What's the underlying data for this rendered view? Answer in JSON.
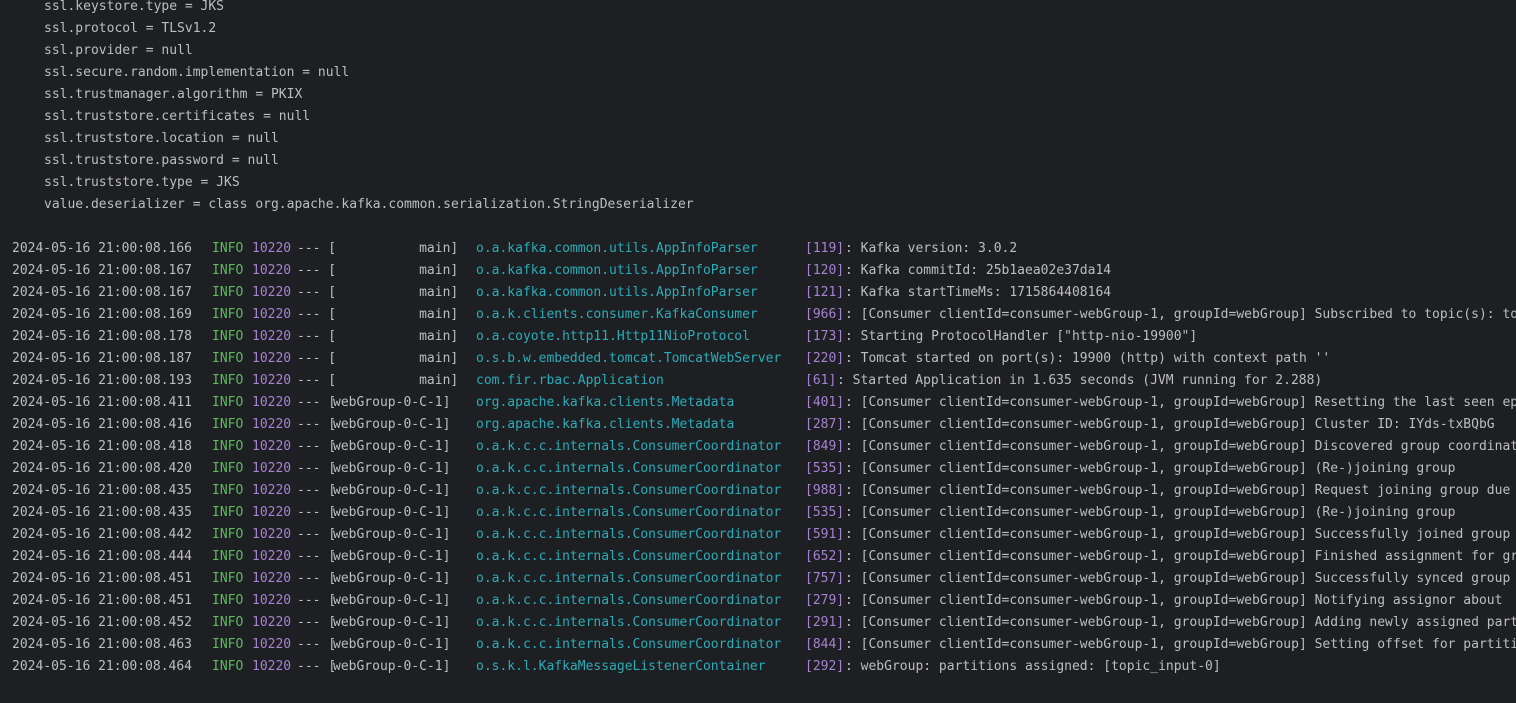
{
  "colors": {
    "background": "#1e1f22",
    "text": "#bcbec4",
    "level_info": "#5fb85f",
    "pid": "#a682d2",
    "logger": "#2aacb8",
    "line_number": "#a682d2"
  },
  "config_lines": [
    "ssl.keystore.type = JKS",
    "ssl.protocol = TLSv1.2",
    "ssl.provider = null",
    "ssl.secure.random.implementation = null",
    "ssl.trustmanager.algorithm = PKIX",
    "ssl.truststore.certificates = null",
    "ssl.truststore.location = null",
    "ssl.truststore.password = null",
    "ssl.truststore.type = JKS",
    "value.deserializer = class org.apache.kafka.common.serialization.StringDeserializer"
  ],
  "log_rows": [
    {
      "ts": "2024-05-16 21:00:08.166",
      "level": "INFO",
      "pid": "10220",
      "sep": "--- [",
      "thread": "           main]",
      "logger": "o.a.kafka.common.utils.AppInfoParser",
      "line": "[119]",
      "msg": ": Kafka version: 3.0.2"
    },
    {
      "ts": "2024-05-16 21:00:08.167",
      "level": "INFO",
      "pid": "10220",
      "sep": "--- [",
      "thread": "           main]",
      "logger": "o.a.kafka.common.utils.AppInfoParser",
      "line": "[120]",
      "msg": ": Kafka commitId: 25b1aea02e37da14"
    },
    {
      "ts": "2024-05-16 21:00:08.167",
      "level": "INFO",
      "pid": "10220",
      "sep": "--- [",
      "thread": "           main]",
      "logger": "o.a.kafka.common.utils.AppInfoParser",
      "line": "[121]",
      "msg": ": Kafka startTimeMs: 1715864408164"
    },
    {
      "ts": "2024-05-16 21:00:08.169",
      "level": "INFO",
      "pid": "10220",
      "sep": "--- [",
      "thread": "           main]",
      "logger": "o.a.k.clients.consumer.KafkaConsumer",
      "line": "[966]",
      "msg": ": [Consumer clientId=consumer-webGroup-1, groupId=webGroup] Subscribed to topic(s): topic_input"
    },
    {
      "ts": "2024-05-16 21:00:08.178",
      "level": "INFO",
      "pid": "10220",
      "sep": "--- [",
      "thread": "           main]",
      "logger": "o.a.coyote.http11.Http11NioProtocol",
      "line": "[173]",
      "msg": ": Starting ProtocolHandler [\"http-nio-19900\"]"
    },
    {
      "ts": "2024-05-16 21:00:08.187",
      "level": "INFO",
      "pid": "10220",
      "sep": "--- [",
      "thread": "           main]",
      "logger": "o.s.b.w.embedded.tomcat.TomcatWebServer",
      "line": "[220]",
      "msg": ": Tomcat started on port(s): 19900 (http) with context path ''"
    },
    {
      "ts": "2024-05-16 21:00:08.193",
      "level": "INFO",
      "pid": "10220",
      "sep": "--- [",
      "thread": "           main]",
      "logger": "com.fir.rbac.Application",
      "line": "[61]",
      "msg": ": Started Application in 1.635 seconds (JVM running for 2.288)",
      "short": true
    },
    {
      "ts": "2024-05-16 21:00:08.411",
      "level": "INFO",
      "pid": "10220",
      "sep": "--- [",
      "thread": "webGroup-0-C-1]",
      "logger": "org.apache.kafka.clients.Metadata",
      "line": "[401]",
      "msg": ": [Consumer clientId=consumer-webGroup-1, groupId=webGroup] Resetting the last seen epoch"
    },
    {
      "ts": "2024-05-16 21:00:08.416",
      "level": "INFO",
      "pid": "10220",
      "sep": "--- [",
      "thread": "webGroup-0-C-1]",
      "logger": "org.apache.kafka.clients.Metadata",
      "line": "[287]",
      "msg": ": [Consumer clientId=consumer-webGroup-1, groupId=webGroup] Cluster ID: IYds-txBQbG"
    },
    {
      "ts": "2024-05-16 21:00:08.418",
      "level": "INFO",
      "pid": "10220",
      "sep": "--- [",
      "thread": "webGroup-0-C-1]",
      "logger": "o.a.k.c.c.internals.ConsumerCoordinator",
      "line": "[849]",
      "msg": ": [Consumer clientId=consumer-webGroup-1, groupId=webGroup] Discovered group coordinator"
    },
    {
      "ts": "2024-05-16 21:00:08.420",
      "level": "INFO",
      "pid": "10220",
      "sep": "--- [",
      "thread": "webGroup-0-C-1]",
      "logger": "o.a.k.c.c.internals.ConsumerCoordinator",
      "line": "[535]",
      "msg": ": [Consumer clientId=consumer-webGroup-1, groupId=webGroup] (Re-)joining group"
    },
    {
      "ts": "2024-05-16 21:00:08.435",
      "level": "INFO",
      "pid": "10220",
      "sep": "--- [",
      "thread": "webGroup-0-C-1]",
      "logger": "o.a.k.c.c.internals.ConsumerCoordinator",
      "line": "[988]",
      "msg": ": [Consumer clientId=consumer-webGroup-1, groupId=webGroup] Request joining group due to"
    },
    {
      "ts": "2024-05-16 21:00:08.435",
      "level": "INFO",
      "pid": "10220",
      "sep": "--- [",
      "thread": "webGroup-0-C-1]",
      "logger": "o.a.k.c.c.internals.ConsumerCoordinator",
      "line": "[535]",
      "msg": ": [Consumer clientId=consumer-webGroup-1, groupId=webGroup] (Re-)joining group"
    },
    {
      "ts": "2024-05-16 21:00:08.442",
      "level": "INFO",
      "pid": "10220",
      "sep": "--- [",
      "thread": "webGroup-0-C-1]",
      "logger": "o.a.k.c.c.internals.ConsumerCoordinator",
      "line": "[591]",
      "msg": ": [Consumer clientId=consumer-webGroup-1, groupId=webGroup] Successfully joined group"
    },
    {
      "ts": "2024-05-16 21:00:08.444",
      "level": "INFO",
      "pid": "10220",
      "sep": "--- [",
      "thread": "webGroup-0-C-1]",
      "logger": "o.a.k.c.c.internals.ConsumerCoordinator",
      "line": "[652]",
      "msg": ": [Consumer clientId=consumer-webGroup-1, groupId=webGroup] Finished assignment for group"
    },
    {
      "ts": "2024-05-16 21:00:08.451",
      "level": "INFO",
      "pid": "10220",
      "sep": "--- [",
      "thread": "webGroup-0-C-1]",
      "logger": "o.a.k.c.c.internals.ConsumerCoordinator",
      "line": "[757]",
      "msg": ": [Consumer clientId=consumer-webGroup-1, groupId=webGroup] Successfully synced group"
    },
    {
      "ts": "2024-05-16 21:00:08.451",
      "level": "INFO",
      "pid": "10220",
      "sep": "--- [",
      "thread": "webGroup-0-C-1]",
      "logger": "o.a.k.c.c.internals.ConsumerCoordinator",
      "line": "[279]",
      "msg": ": [Consumer clientId=consumer-webGroup-1, groupId=webGroup] Notifying assignor about"
    },
    {
      "ts": "2024-05-16 21:00:08.452",
      "level": "INFO",
      "pid": "10220",
      "sep": "--- [",
      "thread": "webGroup-0-C-1]",
      "logger": "o.a.k.c.c.internals.ConsumerCoordinator",
      "line": "[291]",
      "msg": ": [Consumer clientId=consumer-webGroup-1, groupId=webGroup] Adding newly assigned partitions"
    },
    {
      "ts": "2024-05-16 21:00:08.463",
      "level": "INFO",
      "pid": "10220",
      "sep": "--- [",
      "thread": "webGroup-0-C-1]",
      "logger": "o.a.k.c.c.internals.ConsumerCoordinator",
      "line": "[844]",
      "msg": ": [Consumer clientId=consumer-webGroup-1, groupId=webGroup] Setting offset for partition"
    },
    {
      "ts": "2024-05-16 21:00:08.464",
      "level": "INFO",
      "pid": "10220",
      "sep": "--- [",
      "thread": "webGroup-0-C-1]",
      "logger": "o.s.k.l.KafkaMessageListenerContainer",
      "line": "[292]",
      "msg": ": webGroup: partitions assigned: [topic_input-0]"
    }
  ]
}
